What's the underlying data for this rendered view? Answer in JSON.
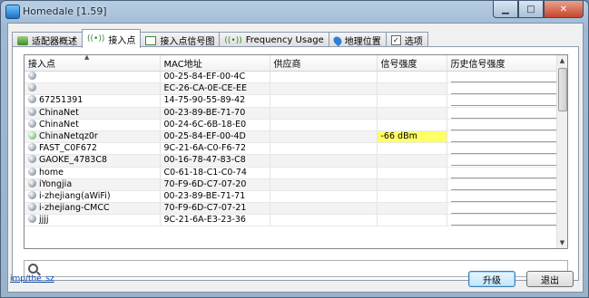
{
  "window": {
    "title": "Homedale [1.59]"
  },
  "tabs": [
    {
      "label": "适配器概述",
      "icon": "network-adapter-icon"
    },
    {
      "label": "接入点",
      "icon": "wifi-signal-icon"
    },
    {
      "label": "接入点信号图",
      "icon": "signal-graph-icon"
    },
    {
      "label": "Frequency Usage",
      "icon": "frequency-graph-icon"
    },
    {
      "label": "地理位置",
      "icon": "location-pin-icon"
    },
    {
      "label": "选项",
      "icon": "options-checkbox-icon"
    }
  ],
  "table": {
    "columns": [
      "接入点",
      "MAC地址",
      "供应商",
      "信号强度",
      "历史信号强度"
    ],
    "rows": [
      {
        "ap": "",
        "mac": "00-25-84-EF-00-4C",
        "vendor": "",
        "signal": ""
      },
      {
        "ap": "",
        "mac": "EC-26-CA-0E-CE-EE",
        "vendor": "",
        "signal": ""
      },
      {
        "ap": "67251391",
        "mac": "14-75-90-55-89-42",
        "vendor": "",
        "signal": ""
      },
      {
        "ap": "ChinaNet",
        "mac": "00-23-89-BE-71-70",
        "vendor": "",
        "signal": ""
      },
      {
        "ap": "ChinaNet",
        "mac": "00-24-6C-6B-18-E0",
        "vendor": "",
        "signal": ""
      },
      {
        "ap": "ChinaNetqz0r",
        "mac": "00-25-84-EF-00-4D",
        "vendor": "",
        "signal": "-66 dBm"
      },
      {
        "ap": "FAST_C0F672",
        "mac": "9C-21-6A-C0-F6-72",
        "vendor": "",
        "signal": ""
      },
      {
        "ap": "GAOKE_4783C8",
        "mac": "00-16-78-47-83-C8",
        "vendor": "",
        "signal": ""
      },
      {
        "ap": "home",
        "mac": "C0-61-18-C1-C0-74",
        "vendor": "",
        "signal": ""
      },
      {
        "ap": "iYongjia",
        "mac": "70-F9-6D-C7-07-20",
        "vendor": "",
        "signal": ""
      },
      {
        "ap": "i-zhejiang(aWiFi)",
        "mac": "00-23-89-BE-71-71",
        "vendor": "",
        "signal": ""
      },
      {
        "ap": "i-zhejiang-CMCC",
        "mac": "70-F9-6D-C7-07-21",
        "vendor": "",
        "signal": ""
      },
      {
        "ap": "jjjj",
        "mac": "9C-21-6A-E3-23-36",
        "vendor": "",
        "signal": ""
      }
    ]
  },
  "search": {
    "value": ""
  },
  "footer": {
    "link": "imp/the_sz",
    "upgrade": "升级",
    "exit": "退出"
  },
  "colors": {
    "signal_highlight": "#ffff66",
    "titlebar": "#b7cde3"
  }
}
